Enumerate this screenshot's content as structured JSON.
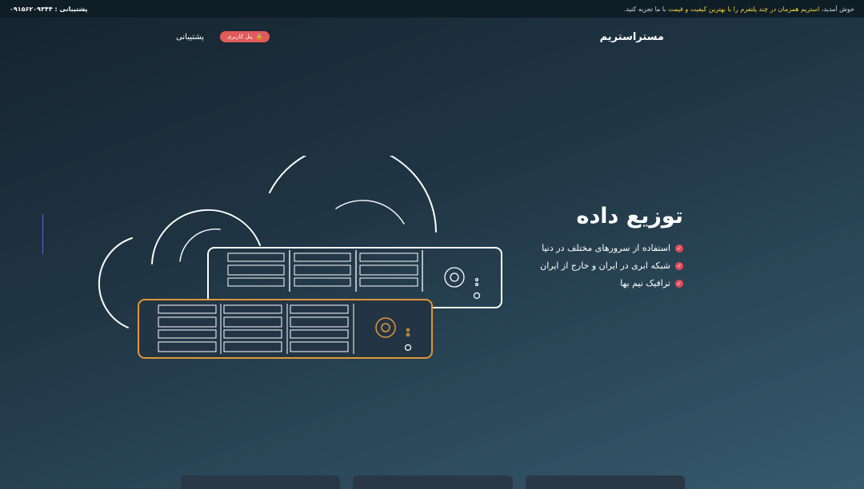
{
  "topbar": {
    "welcome_prefix": "خوش آمدید،",
    "welcome_highlight": "استریم همزمان در چند پلتفرم را با بهترین کیفیت و قیمت",
    "welcome_suffix": "با ما تجربه کنید.",
    "support_label": "پشتیبانی :",
    "support_phone": "۰۹۱۵۶۲۰۹۳۴۴"
  },
  "nav": {
    "brand": "مستراستریم",
    "portal_button": "پنل کاربری",
    "support_link": "پشتیبانی"
  },
  "hero": {
    "title": "توزیع داده",
    "features": [
      "استفاده از سرورهای مختلف در دنیا",
      "شبکه ابری در ایران و خارج از ایران",
      "ترافیک نیم بها"
    ]
  },
  "colors": {
    "accent_red": "#e05a5a",
    "highlight_yellow": "#f3d33b",
    "server_orange": "#e0963a"
  }
}
